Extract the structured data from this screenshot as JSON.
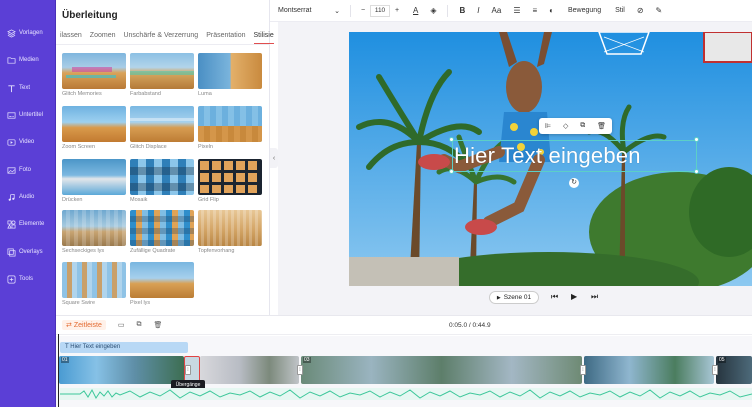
{
  "sidebar": {
    "items": [
      {
        "label": "Vorlagen",
        "icon": "layers-icon"
      },
      {
        "label": "Medien",
        "icon": "folder-icon"
      },
      {
        "label": "Text",
        "icon": "text-icon"
      },
      {
        "label": "Untertitel",
        "icon": "subtitle-icon"
      },
      {
        "label": "Video",
        "icon": "video-icon"
      },
      {
        "label": "Foto",
        "icon": "photo-icon"
      },
      {
        "label": "Audio",
        "icon": "music-icon"
      },
      {
        "label": "Elemente",
        "icon": "elements-icon"
      },
      {
        "label": "Overlays",
        "icon": "overlays-icon"
      },
      {
        "label": "Tools",
        "icon": "tools-icon"
      }
    ]
  },
  "panel": {
    "title": "Überleitung",
    "tabs": [
      "ilassen",
      "Zoomen",
      "Unschärfe & Verzerrung",
      "Präsentation",
      "Stilisie"
    ],
    "active_tab": "Stilisie",
    "transitions": [
      "Glitch Memories",
      "Farbabstand",
      "Luma",
      "Zoom Screen",
      "Glitch Displace",
      "Pixeln",
      "Drücken",
      "Mosaik",
      "Grid Flip",
      "Sechseckiges lys",
      "Zufällige Quadrate",
      "Topfenvorhang",
      "Square Swire",
      "Pixel lys"
    ]
  },
  "toolbar": {
    "font": "Montserrat",
    "font_size": "110",
    "minus": "−",
    "plus": "+",
    "bold": "B",
    "italic": "I",
    "case": "Aa",
    "motion_label": "Bewegung",
    "style_label": "Stil"
  },
  "canvas": {
    "overlay_text": "Hier Text eingeben",
    "scene_label": "Szene 01"
  },
  "timeline": {
    "zeitleiste_label": "Zeitleiste",
    "time": "0:05.0 / 0:44.9",
    "text_track": "Hier Text eingeben",
    "clips": [
      "01",
      "03",
      "05"
    ],
    "tooltip": "Übergänge"
  }
}
